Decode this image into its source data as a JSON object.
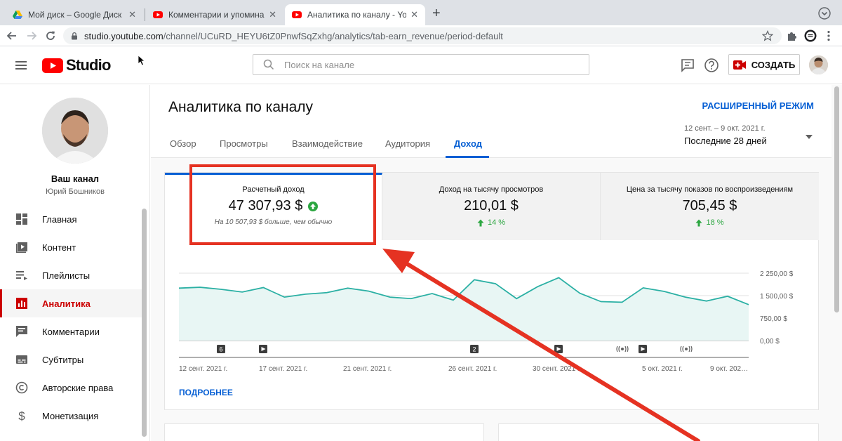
{
  "browser": {
    "tabs": [
      {
        "title": "Мой диск – Google Диск",
        "favicon": "google-drive-icon"
      },
      {
        "title": "Комментарии и упоминания",
        "favicon": "youtube-icon"
      },
      {
        "title": "Аналитика по каналу - YouTube",
        "favicon": "youtube-icon",
        "active": true
      }
    ],
    "new_tab": "+",
    "url_host": "studio.youtube.com",
    "url_path": "/channel/UCuRD_HEYU6tZ0PnwfSqZxhg/analytics/tab-earn_revenue/period-default"
  },
  "header": {
    "logo_text": "Studio",
    "search_placeholder": "Поиск на канале",
    "create_label": "СОЗДАТЬ"
  },
  "sidebar": {
    "channel_title": "Ваш канал",
    "channel_name": "Юрий Бошников",
    "items": [
      {
        "label": "Главная",
        "icon": "dashboard-icon"
      },
      {
        "label": "Контент",
        "icon": "content-icon"
      },
      {
        "label": "Плейлисты",
        "icon": "playlists-icon"
      },
      {
        "label": "Аналитика",
        "icon": "analytics-icon",
        "active": true
      },
      {
        "label": "Комментарии",
        "icon": "comments-icon"
      },
      {
        "label": "Субтитры",
        "icon": "subtitles-icon"
      },
      {
        "label": "Авторские права",
        "icon": "copyright-icon"
      },
      {
        "label": "Монетизация",
        "icon": "monetization-icon"
      }
    ]
  },
  "page": {
    "title": "Аналитика по каналу",
    "advanced_link": "РАСШИРЕННЫЙ РЕЖИМ",
    "tabs": [
      "Обзор",
      "Просмотры",
      "Взаимодействие",
      "Аудитория",
      "Доход"
    ],
    "active_tab": "Доход",
    "period_range": "12 сент. – 9 окт. 2021 г.",
    "period_label": "Последние 28 дней",
    "more_link": "ПОДРОБНЕЕ"
  },
  "metrics": [
    {
      "label": "Расчетный доход",
      "value": "47 307,93 $",
      "sub": "На 10 507,93 $ больше, чем обычно",
      "active": true
    },
    {
      "label": "Доход на тысячу просмотров",
      "value": "210,01 $",
      "change": "14 %"
    },
    {
      "label": "Цена за тысячу показов по воспроизведениям",
      "value": "705,45 $",
      "change": "18 %"
    }
  ],
  "colors": {
    "accent": "#065fd4",
    "brand_red": "#ff0000",
    "line": "#2bb0a4",
    "area": "#e8f6f4",
    "positive": "#2ba640",
    "annotation": "#e53222"
  },
  "chart_data": {
    "type": "area",
    "x": [
      "12 сент.",
      "13 сент.",
      "14 сент.",
      "15 сент.",
      "16 сент.",
      "17 сент.",
      "18 сент.",
      "19 сент.",
      "20 сент.",
      "21 сент.",
      "22 сент.",
      "23 сент.",
      "24 сент.",
      "25 сент.",
      "26 сент.",
      "27 сент.",
      "28 сент.",
      "29 сент.",
      "30 сент.",
      "1 окт.",
      "2 окт.",
      "3 окт.",
      "4 окт.",
      "5 окт.",
      "6 окт.",
      "7 окт.",
      "8 окт.",
      "9 окт."
    ],
    "series": [
      {
        "values": [
          1750,
          1780,
          1710,
          1620,
          1770,
          1450,
          1550,
          1600,
          1750,
          1650,
          1450,
          1400,
          1570,
          1350,
          2030,
          1900,
          1400,
          1800,
          2100,
          1580,
          1300,
          1280,
          1760,
          1640,
          1450,
          1320,
          1480,
          1200
        ]
      }
    ],
    "ylim": [
      0,
      2250
    ],
    "y_ticks": [
      "0,00 $",
      "750,00 $",
      "1 500,00 $",
      "2 250,00 $"
    ],
    "x_ticks": [
      "12 сент. 2021 г.",
      "17 сент. 2021 г.",
      "21 сент. 2021 г.",
      "26 сент. 2021 г.",
      "30 сент. 2021 г.",
      "5 окт. 2021 г.",
      "9 окт. 202…"
    ],
    "markers": [
      "6",
      "video",
      "2",
      "video",
      "live",
      "video",
      "live"
    ],
    "grid": true
  }
}
